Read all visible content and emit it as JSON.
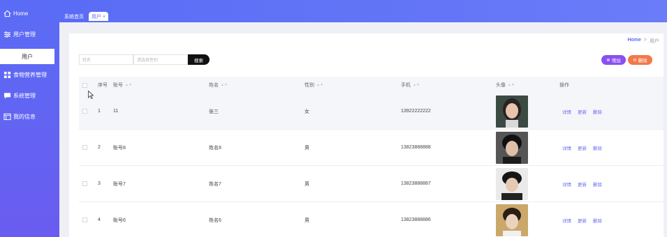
{
  "sidebar": {
    "home": "Home",
    "user_mgmt": "用户管理",
    "user_sub": "用户",
    "food_mgmt": "食物营养管理",
    "sys_mgmt": "系统管理",
    "my_info": "我的信息"
  },
  "tabs": [
    "系统首页",
    "用户 ×"
  ],
  "breadcrumb": {
    "home": "Home",
    "sep": ">",
    "current": "用户"
  },
  "search": {
    "name_placeholder": "姓名",
    "gender_placeholder": "请选择性别",
    "button": "搜索"
  },
  "actions": {
    "add": "增加",
    "delete": "删除"
  },
  "table": {
    "headers": {
      "index": "序号",
      "account": "账号",
      "name": "姓名",
      "gender": "性别",
      "phone": "手机",
      "avatar": "头像",
      "ops": "操作"
    },
    "rows": [
      {
        "index": "1",
        "account": "11",
        "name": "张三",
        "gender": "女",
        "phone": "13922222222"
      },
      {
        "index": "2",
        "account": "账号8",
        "name": "姓名8",
        "gender": "男",
        "phone": "13823888888"
      },
      {
        "index": "3",
        "account": "账号7",
        "name": "姓名7",
        "gender": "男",
        "phone": "13823888887"
      },
      {
        "index": "4",
        "account": "账号6",
        "name": "姓名6",
        "gender": "男",
        "phone": "13823888886"
      }
    ],
    "op_labels": {
      "detail": "详情",
      "update": "更新",
      "delete": "删除"
    }
  },
  "colors": {
    "primary": "#5a6cf5",
    "add": "#8a4ff2",
    "delete": "#f2794b",
    "link": "#6a6cf0"
  }
}
